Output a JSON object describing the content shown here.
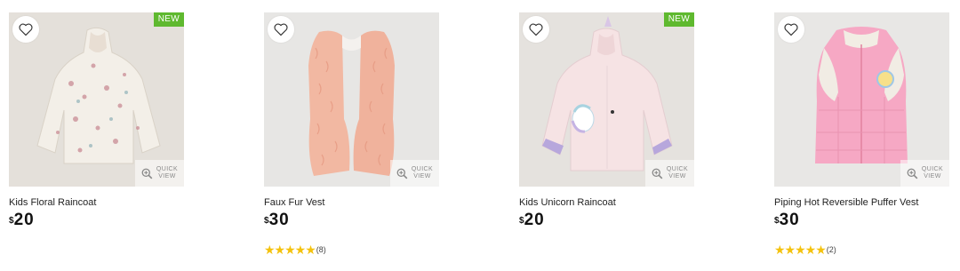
{
  "products": [
    {
      "name": "Kids Floral Raincoat",
      "currency": "$",
      "price": "20",
      "badge": "NEW",
      "quick_view": [
        "QUICK",
        "VIEW"
      ],
      "rating_count": null
    },
    {
      "name": "Faux Fur Vest",
      "currency": "$",
      "price": "30",
      "badge": null,
      "quick_view": [
        "QUICK",
        "VIEW"
      ],
      "rating_stars": "★★★★★",
      "rating_count": "(8)"
    },
    {
      "name": "Kids Unicorn Raincoat",
      "currency": "$",
      "price": "20",
      "badge": "NEW",
      "quick_view": [
        "QUICK",
        "VIEW"
      ],
      "rating_count": null
    },
    {
      "name": "Piping Hot Reversible Puffer Vest",
      "currency": "$",
      "price": "30",
      "badge": null,
      "quick_view": [
        "QUICK",
        "VIEW"
      ],
      "rating_stars": "★★★★★",
      "rating_count": "(2)"
    }
  ],
  "colors": {
    "badge": "#5fb92f",
    "stars": "#f4c20d",
    "image_bg": "#e4e2df"
  },
  "icons": {
    "favorite": "heart-outline-icon",
    "quick_view": "zoom-plus-icon"
  }
}
